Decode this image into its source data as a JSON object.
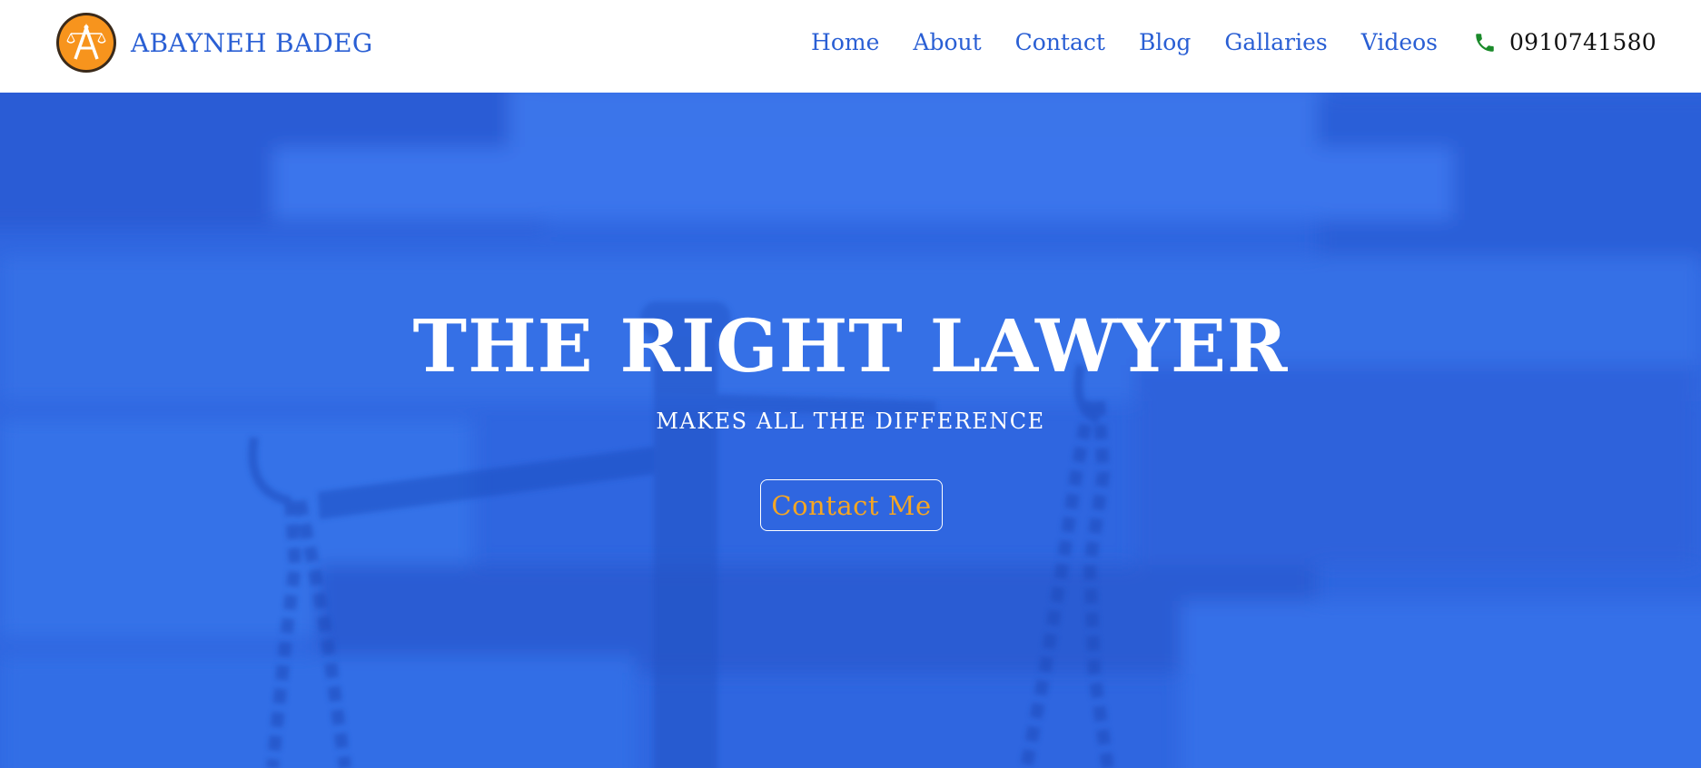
{
  "brand": {
    "logo_icon": "scales-of-justice-letter-a-icon",
    "logo_color": "#f7941d",
    "name": "ABAYNEH BADEG"
  },
  "nav": {
    "items": [
      {
        "label": "Home"
      },
      {
        "label": "About"
      },
      {
        "label": "Contact"
      },
      {
        "label": "Blog"
      },
      {
        "label": "Gallaries"
      },
      {
        "label": "Videos"
      }
    ],
    "link_color": "#2a5fd4"
  },
  "phone": {
    "icon": "phone-icon",
    "icon_color": "#1a8a2a",
    "number": "0910741580"
  },
  "hero": {
    "background_image": "scales-of-justice-photo",
    "overlay_color": "#2f66e0",
    "title": "THE RIGHT LAWYER",
    "subtitle": "MAKES ALL THE DIFFERENCE",
    "cta_label": "Contact Me",
    "cta_color": "#f5a623"
  }
}
